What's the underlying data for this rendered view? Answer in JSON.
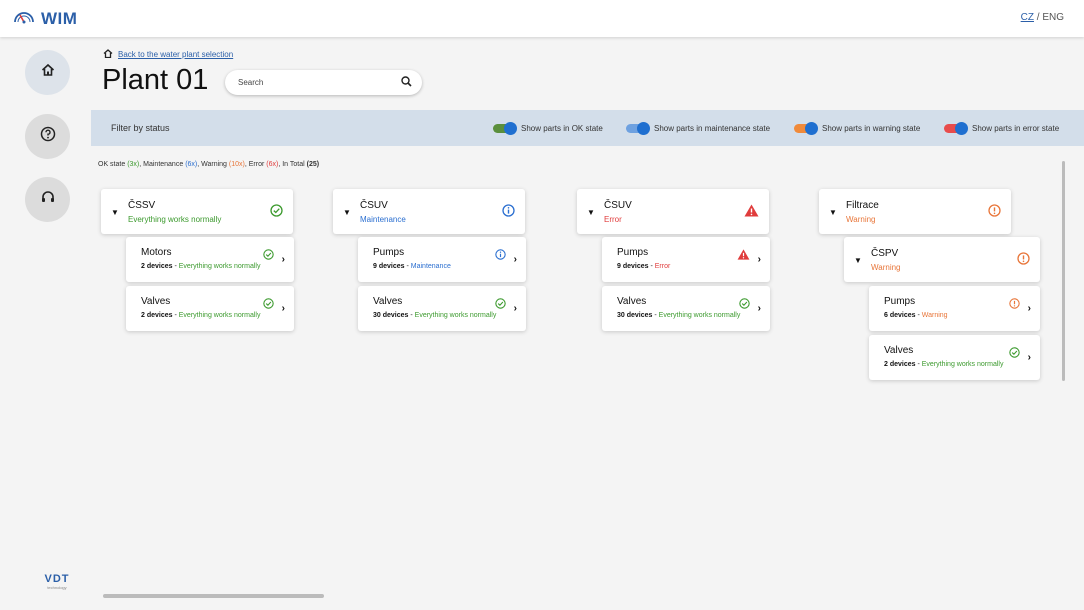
{
  "app": {
    "name": "WIM"
  },
  "lang": {
    "cz": "CZ",
    "separator": "/",
    "en": "ENG"
  },
  "vdt": {
    "logo": "VDT",
    "sub": "technology"
  },
  "back_link": "Back to the water plant selection",
  "title": "Plant 01",
  "search": {
    "placeholder": "Search",
    "value": ""
  },
  "filter": {
    "label": "Filter by status",
    "toggles": [
      {
        "label": "Show parts in OK state",
        "color": "#5a8f3c",
        "on": true
      },
      {
        "label": "Show parts in maintenance state",
        "color": "#6ea1e0",
        "on": true
      },
      {
        "label": "Show parts in warning state",
        "color": "#f08a3a",
        "on": true
      },
      {
        "label": "Show parts in error state",
        "color": "#e84c4c",
        "on": true
      }
    ]
  },
  "summary": {
    "ok_label": "OK state",
    "ok_count": "(3x)",
    "mt_label": "Maintenance",
    "mt_count": "(6x)",
    "wr_label": "Warning",
    "wr_count": "(10x)",
    "er_label": "Error",
    "er_count": "(6x)",
    "total_label": "In Total",
    "total_count": "(25)"
  },
  "columns": [
    {
      "name": "ČSSV",
      "status": "Everything works normally",
      "state": "ok",
      "children": [
        {
          "name": "Motors",
          "count": "2 devices",
          "status": "Everything works normally",
          "state": "ok"
        },
        {
          "name": "Valves",
          "count": "2 devices",
          "status": "Everything works normally",
          "state": "ok"
        }
      ]
    },
    {
      "name": "ČSUV",
      "status": "Maintenance",
      "state": "mt",
      "children": [
        {
          "name": "Pumps",
          "count": "9 devices",
          "status": "Maintenance",
          "state": "mt"
        },
        {
          "name": "Valves",
          "count": "30 devices",
          "status": "Everything works normally",
          "state": "ok"
        }
      ]
    },
    {
      "name": "ČSUV",
      "status": "Error",
      "state": "er",
      "children": [
        {
          "name": "Pumps",
          "count": "9 devices",
          "status": "Error",
          "state": "er"
        },
        {
          "name": "Valves",
          "count": "30 devices",
          "status": "Everything works normally",
          "state": "ok"
        }
      ]
    },
    {
      "name": "Filtrace",
      "status": "Warning",
      "state": "wr",
      "sub": {
        "name": "ČSPV",
        "status": "Warning",
        "state": "wr",
        "children": [
          {
            "name": "Pumps",
            "count": "6 devices",
            "status": "Warning",
            "state": "wr"
          },
          {
            "name": "Valves",
            "count": "2 devices",
            "status": "Everything works normally",
            "state": "ok"
          }
        ]
      }
    }
  ]
}
